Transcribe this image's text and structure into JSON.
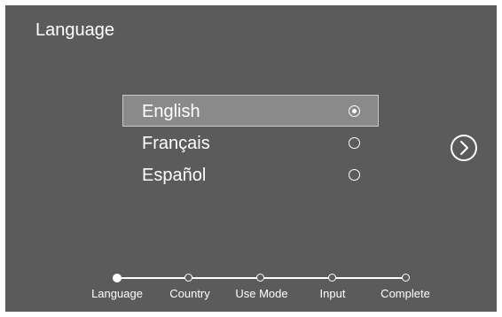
{
  "header": {
    "title": "Language"
  },
  "languages": [
    {
      "label": "English",
      "selected": true
    },
    {
      "label": "Français",
      "selected": false
    },
    {
      "label": "Español",
      "selected": false
    }
  ],
  "navigation": {
    "next_icon": "chevron-right-circle-icon"
  },
  "progress": {
    "current_step": 1,
    "steps": [
      {
        "label": "Language"
      },
      {
        "label": "Country"
      },
      {
        "label": "Use Mode"
      },
      {
        "label": "Input"
      },
      {
        "label": "Complete"
      }
    ]
  },
  "colors": {
    "background": "#5b5b5b",
    "selected_row": "#8a8a8a",
    "text": "#ffffff"
  }
}
